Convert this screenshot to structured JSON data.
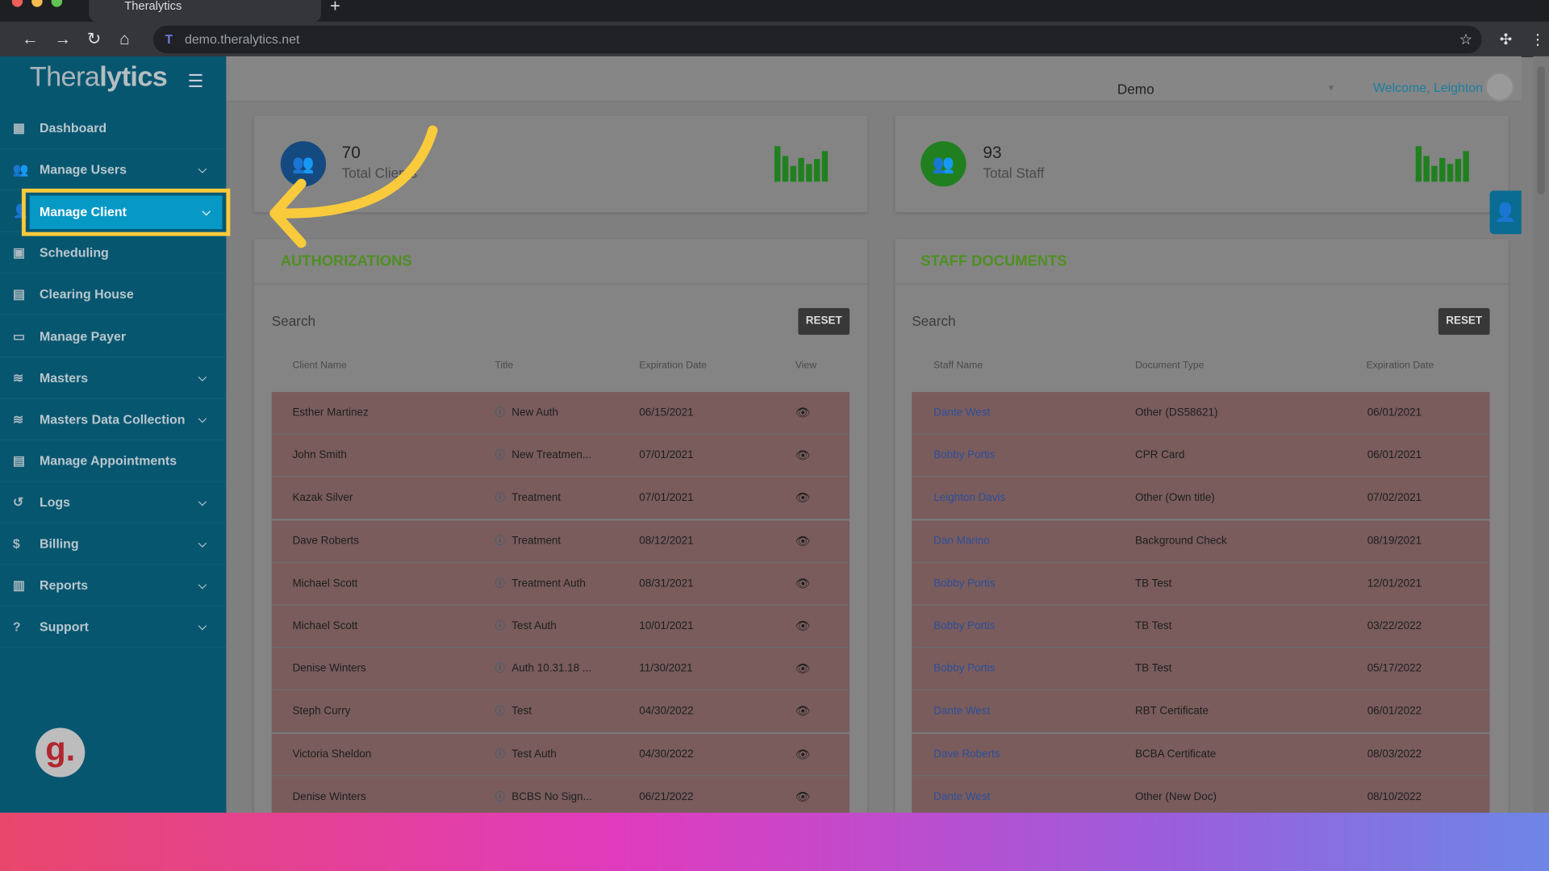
{
  "browser": {
    "tab_title": "Theralytics",
    "url": "demo.theralytics.net"
  },
  "sidebar": {
    "logo": "Theralytics",
    "items": [
      {
        "label": "Dashboard",
        "icon": "dashboard-icon",
        "chevron": false
      },
      {
        "label": "Manage Users",
        "icon": "users-icon",
        "chevron": true
      },
      {
        "label": "Manage Client",
        "icon": "user-icon",
        "chevron": true,
        "active": true
      },
      {
        "label": "Scheduling",
        "icon": "calendar-icon",
        "chevron": false
      },
      {
        "label": "Clearing House",
        "icon": "id-card-icon",
        "chevron": false
      },
      {
        "label": "Manage Payer",
        "icon": "payer-icon",
        "chevron": false
      },
      {
        "label": "Masters",
        "icon": "database-icon",
        "chevron": true
      },
      {
        "label": "Masters Data Collection",
        "icon": "database-icon",
        "chevron": true
      },
      {
        "label": "Manage Appointments",
        "icon": "appointments-icon",
        "chevron": false
      },
      {
        "label": "Logs",
        "icon": "history-icon",
        "chevron": true
      },
      {
        "label": "Billing",
        "icon": "dollar-icon",
        "chevron": true
      },
      {
        "label": "Reports",
        "icon": "clipboard-icon",
        "chevron": true
      },
      {
        "label": "Support",
        "icon": "help-icon",
        "chevron": true
      }
    ]
  },
  "header": {
    "org_select": "Demo",
    "welcome": "Welcome, Leighton"
  },
  "stats": [
    {
      "value": "70",
      "label": "Total Clients",
      "color": "#154a80"
    },
    {
      "value": "93",
      "label": "Total Staff",
      "color": "#20801f"
    }
  ],
  "authorizations": {
    "title": "AUTHORIZATIONS",
    "search_placeholder": "Search",
    "reset": "RESET",
    "columns": [
      "Client Name",
      "Title",
      "Expiration Date",
      "View"
    ],
    "rows": [
      [
        "Esther Martinez",
        "New Auth",
        "06/15/2021"
      ],
      [
        "John Smith",
        "New Treatmen...",
        "07/01/2021"
      ],
      [
        "Kazak Silver",
        "Treatment",
        "07/01/2021"
      ],
      [
        "Dave Roberts",
        "Treatment",
        "08/12/2021"
      ],
      [
        "Michael Scott",
        "Treatment Auth",
        "08/31/2021"
      ],
      [
        "Michael Scott",
        "Test Auth",
        "10/01/2021"
      ],
      [
        "Denise Winters",
        "Auth 10.31.18 ...",
        "11/30/2021"
      ],
      [
        "Steph Curry",
        "Test",
        "04/30/2022"
      ],
      [
        "Victoria Sheldon",
        "Test Auth",
        "04/30/2022"
      ],
      [
        "Denise Winters",
        "BCBS No Sign...",
        "06/21/2022"
      ]
    ]
  },
  "staff_documents": {
    "title": "STAFF DOCUMENTS",
    "search_placeholder": "Search",
    "reset": "RESET",
    "columns": [
      "Staff Name",
      "Document Type",
      "Expiration Date"
    ],
    "rows": [
      [
        "Dante West",
        "Other (DS58621)",
        "06/01/2021"
      ],
      [
        "Bobby Portis",
        "CPR Card",
        "06/01/2021"
      ],
      [
        "Leighton Davis",
        "Other (Own title)",
        "07/02/2021"
      ],
      [
        "Dan Marino",
        "Background Check",
        "08/19/2021"
      ],
      [
        "Bobby Portis",
        "TB Test",
        "12/01/2021"
      ],
      [
        "Bobby Portis",
        "TB Test",
        "03/22/2022"
      ],
      [
        "Bobby Portis",
        "TB Test",
        "05/17/2022"
      ],
      [
        "Dante West",
        "RBT Certificate",
        "06/01/2022"
      ],
      [
        "Dave Roberts",
        "BCBA Certificate",
        "08/03/2022"
      ],
      [
        "Dante West",
        "Other (New Doc)",
        "08/10/2022"
      ]
    ]
  },
  "colors": {
    "highlight": "#f9ca3c",
    "sidebar": "#075670",
    "active": "#0799c6",
    "row_expired": "#7a5c5c"
  }
}
